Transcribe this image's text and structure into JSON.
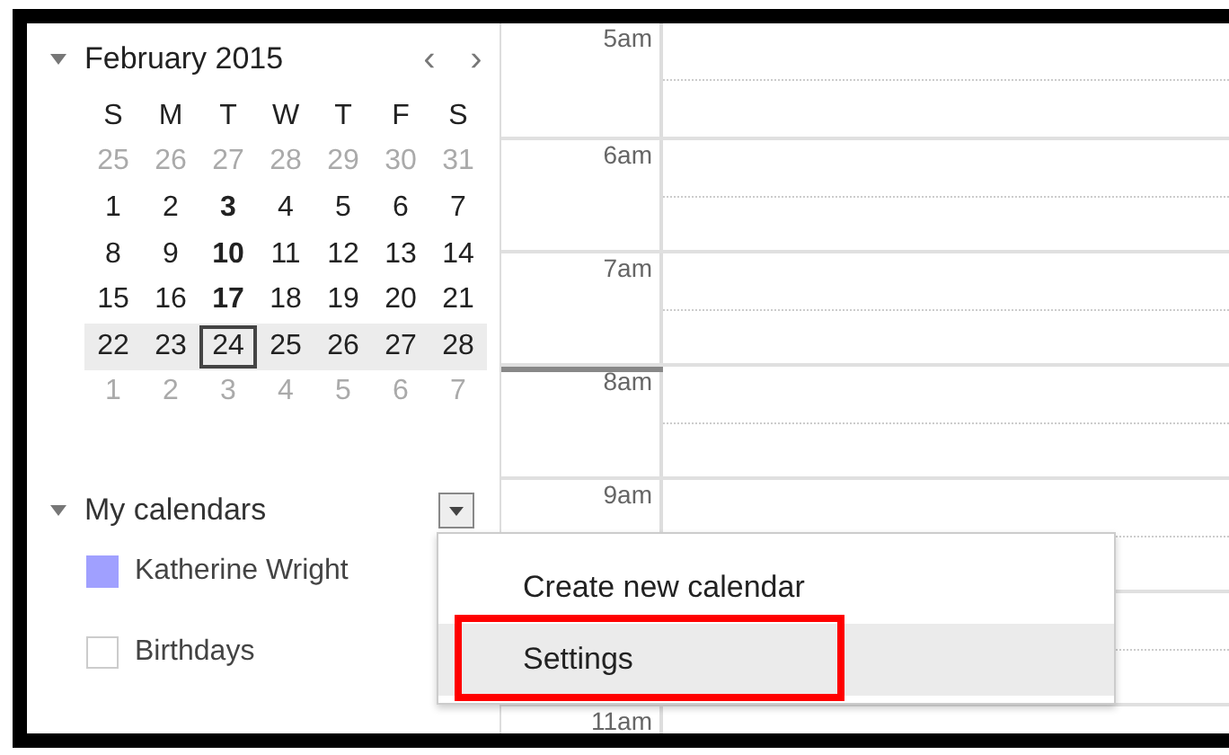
{
  "mini_calendar": {
    "title": "February 2015",
    "prev": "‹",
    "next": "›",
    "weekdays": [
      "S",
      "M",
      "T",
      "W",
      "T",
      "F",
      "S"
    ],
    "weeks": [
      {
        "selected": false,
        "days": [
          {
            "day": "25",
            "other_month": true,
            "today": false,
            "bold": false
          },
          {
            "day": "26",
            "other_month": true,
            "today": false,
            "bold": false
          },
          {
            "day": "27",
            "other_month": true,
            "today": false,
            "bold": false
          },
          {
            "day": "28",
            "other_month": true,
            "today": false,
            "bold": false
          },
          {
            "day": "29",
            "other_month": true,
            "today": false,
            "bold": false
          },
          {
            "day": "30",
            "other_month": true,
            "today": false,
            "bold": false
          },
          {
            "day": "31",
            "other_month": true,
            "today": false,
            "bold": false
          }
        ]
      },
      {
        "selected": false,
        "days": [
          {
            "day": "1",
            "other_month": false,
            "today": false,
            "bold": false
          },
          {
            "day": "2",
            "other_month": false,
            "today": false,
            "bold": false
          },
          {
            "day": "3",
            "other_month": false,
            "today": false,
            "bold": true
          },
          {
            "day": "4",
            "other_month": false,
            "today": false,
            "bold": false
          },
          {
            "day": "5",
            "other_month": false,
            "today": false,
            "bold": false
          },
          {
            "day": "6",
            "other_month": false,
            "today": false,
            "bold": false
          },
          {
            "day": "7",
            "other_month": false,
            "today": false,
            "bold": false
          }
        ]
      },
      {
        "selected": false,
        "days": [
          {
            "day": "8",
            "other_month": false,
            "today": false,
            "bold": false
          },
          {
            "day": "9",
            "other_month": false,
            "today": false,
            "bold": false
          },
          {
            "day": "10",
            "other_month": false,
            "today": false,
            "bold": true
          },
          {
            "day": "11",
            "other_month": false,
            "today": false,
            "bold": false
          },
          {
            "day": "12",
            "other_month": false,
            "today": false,
            "bold": false
          },
          {
            "day": "13",
            "other_month": false,
            "today": false,
            "bold": false
          },
          {
            "day": "14",
            "other_month": false,
            "today": false,
            "bold": false
          }
        ]
      },
      {
        "selected": false,
        "days": [
          {
            "day": "15",
            "other_month": false,
            "today": false,
            "bold": false
          },
          {
            "day": "16",
            "other_month": false,
            "today": false,
            "bold": false
          },
          {
            "day": "17",
            "other_month": false,
            "today": false,
            "bold": true
          },
          {
            "day": "18",
            "other_month": false,
            "today": false,
            "bold": false
          },
          {
            "day": "19",
            "other_month": false,
            "today": false,
            "bold": false
          },
          {
            "day": "20",
            "other_month": false,
            "today": false,
            "bold": false
          },
          {
            "day": "21",
            "other_month": false,
            "today": false,
            "bold": false
          }
        ]
      },
      {
        "selected": true,
        "days": [
          {
            "day": "22",
            "other_month": false,
            "today": false,
            "bold": false
          },
          {
            "day": "23",
            "other_month": false,
            "today": false,
            "bold": false
          },
          {
            "day": "24",
            "other_month": false,
            "today": true,
            "bold": false
          },
          {
            "day": "25",
            "other_month": false,
            "today": false,
            "bold": false
          },
          {
            "day": "26",
            "other_month": false,
            "today": false,
            "bold": false
          },
          {
            "day": "27",
            "other_month": false,
            "today": false,
            "bold": false
          },
          {
            "day": "28",
            "other_month": false,
            "today": false,
            "bold": false
          }
        ]
      },
      {
        "selected": false,
        "days": [
          {
            "day": "1",
            "other_month": true,
            "today": false,
            "bold": false
          },
          {
            "day": "2",
            "other_month": true,
            "today": false,
            "bold": false
          },
          {
            "day": "3",
            "other_month": true,
            "today": false,
            "bold": false
          },
          {
            "day": "4",
            "other_month": true,
            "today": false,
            "bold": false
          },
          {
            "day": "5",
            "other_month": true,
            "today": false,
            "bold": false
          },
          {
            "day": "6",
            "other_month": true,
            "today": false,
            "bold": false
          },
          {
            "day": "7",
            "other_month": true,
            "today": false,
            "bold": false
          }
        ]
      }
    ]
  },
  "my_calendars": {
    "title": "My calendars",
    "expanded": true,
    "items": [
      {
        "name": "Katherine Wright",
        "checked": true,
        "color": "#a0a0ff"
      },
      {
        "name": "Birthdays",
        "checked": false
      }
    ]
  },
  "day_view": {
    "hours": [
      {
        "label": "5am",
        "now": false
      },
      {
        "label": "6am",
        "now": false
      },
      {
        "label": "7am",
        "now": false
      },
      {
        "label": "8am",
        "now": true
      },
      {
        "label": "9am",
        "now": false
      },
      {
        "now": false
      },
      {
        "label": "11am",
        "now": false
      }
    ]
  },
  "menu": {
    "items": [
      {
        "label": "Create new calendar",
        "selected": false,
        "annotated": false
      },
      {
        "label": "Settings",
        "selected": true,
        "annotated": true
      }
    ]
  }
}
